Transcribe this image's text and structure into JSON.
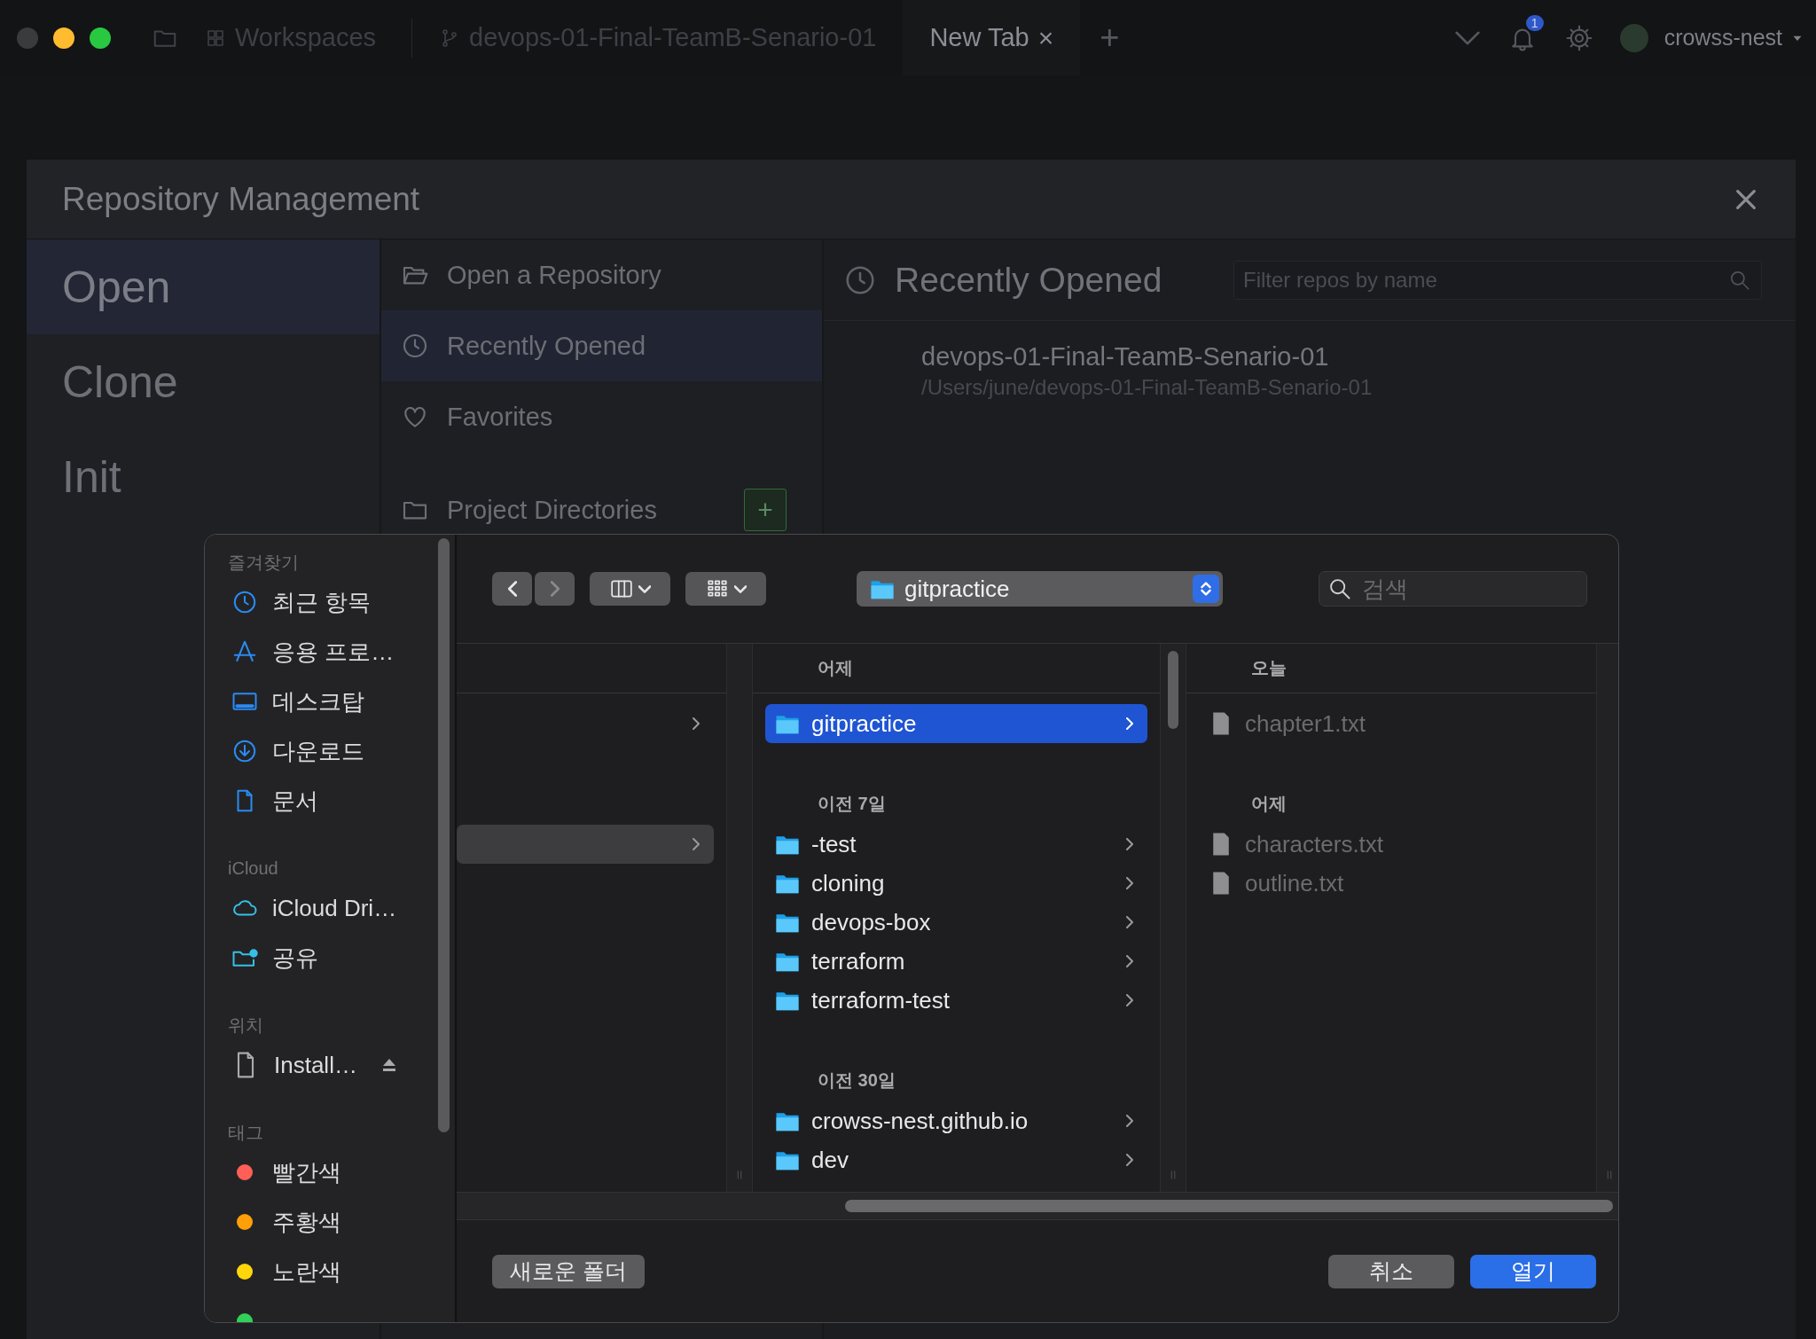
{
  "titlebar": {
    "tabs": [
      {
        "kind": "workspaces",
        "label": "Workspaces",
        "selected": false
      },
      {
        "kind": "branch",
        "label": "devops-01-Final-TeamB-Senario-01",
        "selected": false
      },
      {
        "kind": "plain",
        "label": "New Tab",
        "selected": true,
        "close": "×"
      }
    ],
    "new_tab": "+",
    "notification_count": "1",
    "user": "crowss-nest"
  },
  "repo_dialog": {
    "title": "Repository Management",
    "nav": [
      {
        "label": "Open",
        "selected": true
      },
      {
        "label": "Clone",
        "selected": false
      },
      {
        "label": "Init",
        "selected": false
      }
    ],
    "sections": [
      {
        "kind": "folder-open",
        "label": "Open a Repository",
        "selected": false
      },
      {
        "kind": "clock",
        "label": "Recently Opened",
        "selected": true
      },
      {
        "kind": "heart",
        "label": "Favorites",
        "selected": false
      },
      {
        "kind": "folder",
        "label": "Project Directories",
        "selected": false,
        "add": "+"
      }
    ],
    "panel": {
      "title": "Recently Opened",
      "filter": {
        "placeholder": "Filter repos by name"
      },
      "repos": [
        {
          "name": "devops-01-Final-TeamB-Senario-01",
          "path": "/Users/june/devops-01-Final-TeamB-Senario-01"
        }
      ]
    }
  },
  "file_dialog": {
    "sidebar": [
      {
        "heading": "즐겨찾기",
        "items": [
          {
            "kind": "clock",
            "label": "최근 항목"
          },
          {
            "kind": "apps",
            "label": "응용 프로…"
          },
          {
            "kind": "desktop",
            "label": "데스크탑"
          },
          {
            "kind": "download",
            "label": "다운로드"
          },
          {
            "kind": "document",
            "label": "문서"
          }
        ]
      },
      {
        "heading": "iCloud",
        "items": [
          {
            "kind": "cloud",
            "label": "iCloud Dri…"
          },
          {
            "kind": "shared",
            "label": "공유"
          }
        ]
      },
      {
        "heading": "위치",
        "items": [
          {
            "kind": "disk",
            "label": "Install…",
            "eject": true
          }
        ]
      },
      {
        "heading": "태그",
        "items": [
          {
            "kind": "tag",
            "label": "빨간색",
            "color": "#ff5f57"
          },
          {
            "kind": "tag",
            "label": "주황색",
            "color": "#ff9f0a"
          },
          {
            "kind": "tag",
            "label": "노란색",
            "color": "#ffd60a"
          },
          {
            "kind": "tag",
            "color": "#30d158"
          }
        ]
      }
    ],
    "location": "gitpractice",
    "search": {
      "placeholder": "검색"
    },
    "columns": [
      {
        "focused": false,
        "groups": [
          {
            "rows": [
              {
                "selected": false
              }
            ]
          },
          {
            "rows": [
              {
                "selected": true
              }
            ]
          }
        ]
      },
      {
        "focused": true,
        "groups": [
          {
            "heading": "어제",
            "rows": [
              {
                "kind": "folder",
                "name": "gitpractice",
                "selected": true,
                "disabled": false
              }
            ]
          },
          {
            "heading": "이전 7일",
            "rows": [
              {
                "kind": "folder",
                "name": "-test",
                "selected": false,
                "disabled": false
              },
              {
                "kind": "folder",
                "name": "cloning",
                "selected": false,
                "disabled": false
              },
              {
                "kind": "folder",
                "name": "devops-box",
                "selected": false,
                "disabled": false
              },
              {
                "kind": "folder",
                "name": "terraform",
                "selected": false,
                "disabled": false
              },
              {
                "kind": "folder",
                "name": "terraform-test",
                "selected": false,
                "disabled": false
              }
            ]
          },
          {
            "heading": "이전 30일",
            "rows": [
              {
                "kind": "folder",
                "name": "crowss-nest.github.io",
                "selected": false,
                "disabled": false
              },
              {
                "kind": "folder",
                "name": "dev",
                "selected": false,
                "disabled": false
              }
            ]
          }
        ]
      },
      {
        "focused": false,
        "groups": [
          {
            "heading": "오늘",
            "rows": [
              {
                "kind": "file",
                "name": "chapter1.txt",
                "selected": false,
                "disabled": true
              }
            ]
          },
          {
            "heading": "어제",
            "rows": [
              {
                "kind": "file",
                "name": "characters.txt",
                "selected": false,
                "disabled": true
              },
              {
                "kind": "file",
                "name": "outline.txt",
                "selected": false,
                "disabled": true
              }
            ]
          }
        ]
      }
    ],
    "buttons": [
      {
        "kind": "new-folder",
        "label": "새로운 폴더"
      },
      {
        "kind": "cancel",
        "label": "취소"
      },
      {
        "kind": "open",
        "label": "열기"
      }
    ]
  }
}
